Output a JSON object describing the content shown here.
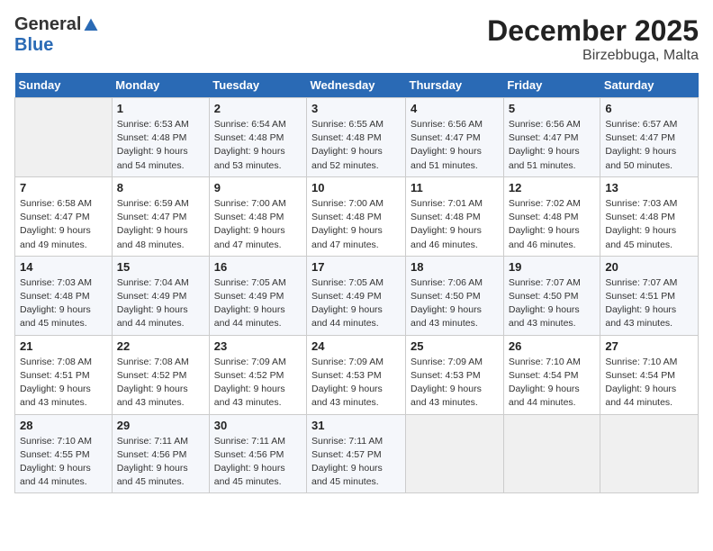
{
  "logo": {
    "general": "General",
    "blue": "Blue"
  },
  "title": "December 2025",
  "subtitle": "Birzebbuga, Malta",
  "days_header": [
    "Sunday",
    "Monday",
    "Tuesday",
    "Wednesday",
    "Thursday",
    "Friday",
    "Saturday"
  ],
  "weeks": [
    [
      {
        "day": "",
        "info": ""
      },
      {
        "day": "1",
        "info": "Sunrise: 6:53 AM\nSunset: 4:48 PM\nDaylight: 9 hours\nand 54 minutes."
      },
      {
        "day": "2",
        "info": "Sunrise: 6:54 AM\nSunset: 4:48 PM\nDaylight: 9 hours\nand 53 minutes."
      },
      {
        "day": "3",
        "info": "Sunrise: 6:55 AM\nSunset: 4:48 PM\nDaylight: 9 hours\nand 52 minutes."
      },
      {
        "day": "4",
        "info": "Sunrise: 6:56 AM\nSunset: 4:47 PM\nDaylight: 9 hours\nand 51 minutes."
      },
      {
        "day": "5",
        "info": "Sunrise: 6:56 AM\nSunset: 4:47 PM\nDaylight: 9 hours\nand 51 minutes."
      },
      {
        "day": "6",
        "info": "Sunrise: 6:57 AM\nSunset: 4:47 PM\nDaylight: 9 hours\nand 50 minutes."
      }
    ],
    [
      {
        "day": "7",
        "info": "Sunrise: 6:58 AM\nSunset: 4:47 PM\nDaylight: 9 hours\nand 49 minutes."
      },
      {
        "day": "8",
        "info": "Sunrise: 6:59 AM\nSunset: 4:47 PM\nDaylight: 9 hours\nand 48 minutes."
      },
      {
        "day": "9",
        "info": "Sunrise: 7:00 AM\nSunset: 4:48 PM\nDaylight: 9 hours\nand 47 minutes."
      },
      {
        "day": "10",
        "info": "Sunrise: 7:00 AM\nSunset: 4:48 PM\nDaylight: 9 hours\nand 47 minutes."
      },
      {
        "day": "11",
        "info": "Sunrise: 7:01 AM\nSunset: 4:48 PM\nDaylight: 9 hours\nand 46 minutes."
      },
      {
        "day": "12",
        "info": "Sunrise: 7:02 AM\nSunset: 4:48 PM\nDaylight: 9 hours\nand 46 minutes."
      },
      {
        "day": "13",
        "info": "Sunrise: 7:03 AM\nSunset: 4:48 PM\nDaylight: 9 hours\nand 45 minutes."
      }
    ],
    [
      {
        "day": "14",
        "info": "Sunrise: 7:03 AM\nSunset: 4:48 PM\nDaylight: 9 hours\nand 45 minutes."
      },
      {
        "day": "15",
        "info": "Sunrise: 7:04 AM\nSunset: 4:49 PM\nDaylight: 9 hours\nand 44 minutes."
      },
      {
        "day": "16",
        "info": "Sunrise: 7:05 AM\nSunset: 4:49 PM\nDaylight: 9 hours\nand 44 minutes."
      },
      {
        "day": "17",
        "info": "Sunrise: 7:05 AM\nSunset: 4:49 PM\nDaylight: 9 hours\nand 44 minutes."
      },
      {
        "day": "18",
        "info": "Sunrise: 7:06 AM\nSunset: 4:50 PM\nDaylight: 9 hours\nand 43 minutes."
      },
      {
        "day": "19",
        "info": "Sunrise: 7:07 AM\nSunset: 4:50 PM\nDaylight: 9 hours\nand 43 minutes."
      },
      {
        "day": "20",
        "info": "Sunrise: 7:07 AM\nSunset: 4:51 PM\nDaylight: 9 hours\nand 43 minutes."
      }
    ],
    [
      {
        "day": "21",
        "info": "Sunrise: 7:08 AM\nSunset: 4:51 PM\nDaylight: 9 hours\nand 43 minutes."
      },
      {
        "day": "22",
        "info": "Sunrise: 7:08 AM\nSunset: 4:52 PM\nDaylight: 9 hours\nand 43 minutes."
      },
      {
        "day": "23",
        "info": "Sunrise: 7:09 AM\nSunset: 4:52 PM\nDaylight: 9 hours\nand 43 minutes."
      },
      {
        "day": "24",
        "info": "Sunrise: 7:09 AM\nSunset: 4:53 PM\nDaylight: 9 hours\nand 43 minutes."
      },
      {
        "day": "25",
        "info": "Sunrise: 7:09 AM\nSunset: 4:53 PM\nDaylight: 9 hours\nand 43 minutes."
      },
      {
        "day": "26",
        "info": "Sunrise: 7:10 AM\nSunset: 4:54 PM\nDaylight: 9 hours\nand 44 minutes."
      },
      {
        "day": "27",
        "info": "Sunrise: 7:10 AM\nSunset: 4:54 PM\nDaylight: 9 hours\nand 44 minutes."
      }
    ],
    [
      {
        "day": "28",
        "info": "Sunrise: 7:10 AM\nSunset: 4:55 PM\nDaylight: 9 hours\nand 44 minutes."
      },
      {
        "day": "29",
        "info": "Sunrise: 7:11 AM\nSunset: 4:56 PM\nDaylight: 9 hours\nand 45 minutes."
      },
      {
        "day": "30",
        "info": "Sunrise: 7:11 AM\nSunset: 4:56 PM\nDaylight: 9 hours\nand 45 minutes."
      },
      {
        "day": "31",
        "info": "Sunrise: 7:11 AM\nSunset: 4:57 PM\nDaylight: 9 hours\nand 45 minutes."
      },
      {
        "day": "",
        "info": ""
      },
      {
        "day": "",
        "info": ""
      },
      {
        "day": "",
        "info": ""
      }
    ]
  ]
}
